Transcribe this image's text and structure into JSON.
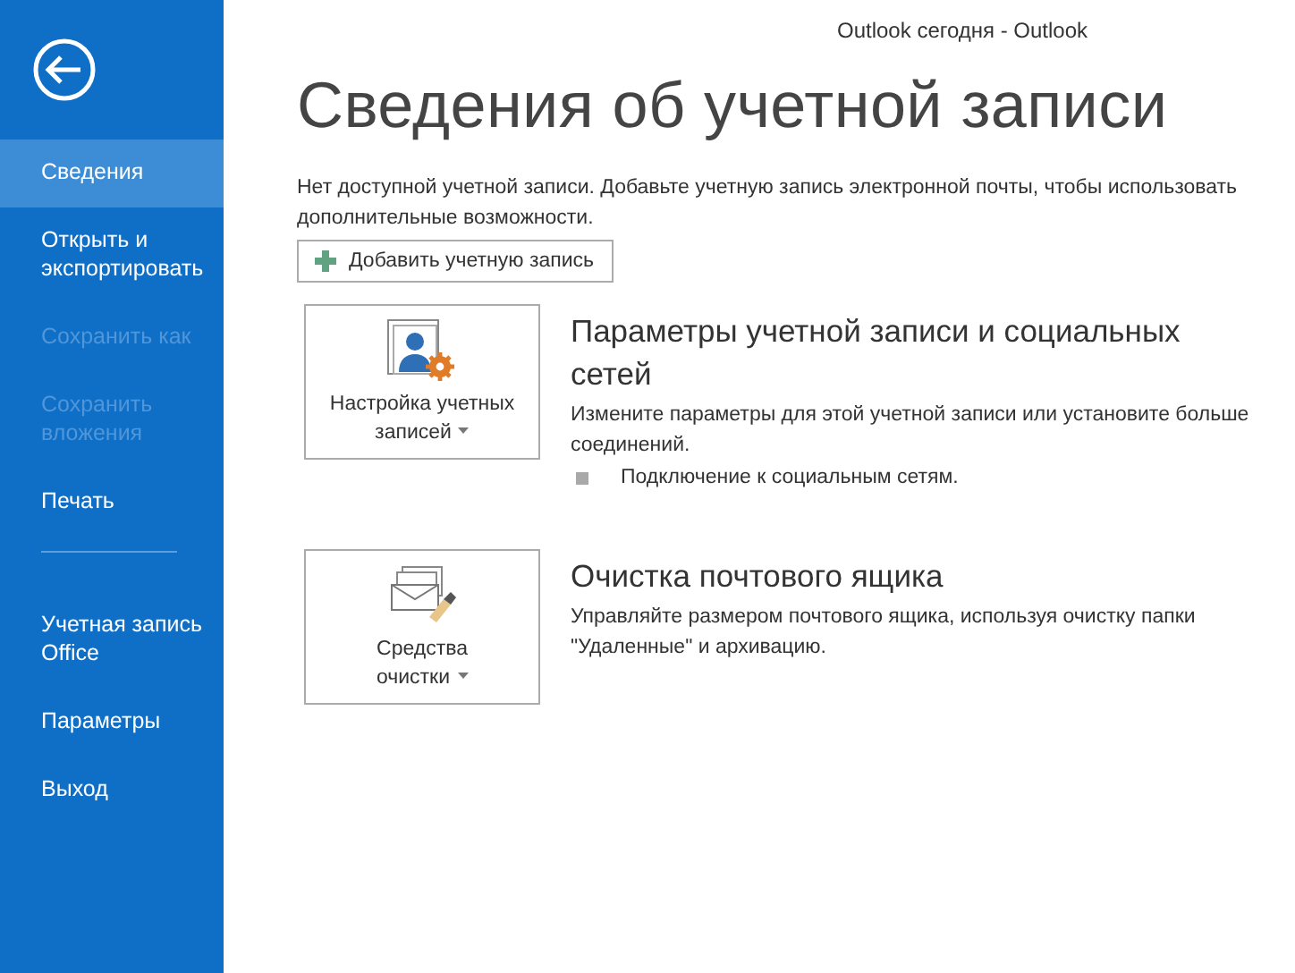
{
  "window": {
    "title": "Outlook сегодня - Outlook"
  },
  "sidebar": {
    "items": [
      {
        "kind": "item",
        "label": "Сведения",
        "selected": true,
        "disabled": false
      },
      {
        "kind": "item",
        "label": "Открыть и экспортировать",
        "selected": false,
        "disabled": false
      },
      {
        "kind": "item",
        "label": "Сохранить как",
        "selected": false,
        "disabled": true
      },
      {
        "kind": "item",
        "label": "Сохранить вложения",
        "selected": false,
        "disabled": true
      },
      {
        "kind": "item",
        "label": "Печать",
        "selected": false,
        "disabled": false
      },
      {
        "kind": "divider"
      },
      {
        "kind": "item",
        "label": "Учетная запись Office",
        "selected": false,
        "disabled": false
      },
      {
        "kind": "item",
        "label": "Параметры",
        "selected": false,
        "disabled": false
      },
      {
        "kind": "item",
        "label": "Выход",
        "selected": false,
        "disabled": false
      }
    ]
  },
  "page": {
    "heading": "Сведения об учетной записи",
    "notice": "Нет доступной учетной записи. Добавьте учетную запись электронной почты, чтобы использовать дополнительные возможности.",
    "add_button": "Добавить учетную запись",
    "sections": [
      {
        "kind": "accounts",
        "button": "Настройка учетных записей",
        "title": "Параметры учетной записи и социальных сетей",
        "description": "Измените параметры для этой учетной записи или установите больше соединений.",
        "bullets": [
          "Подключение к социальным сетям."
        ]
      },
      {
        "kind": "cleanup",
        "button": "Средства очистки",
        "title": "Очистка почтового ящика",
        "description": "Управляйте размером почтового ящика, используя очистку папки \"Удаленные\" и архивацию."
      }
    ]
  }
}
